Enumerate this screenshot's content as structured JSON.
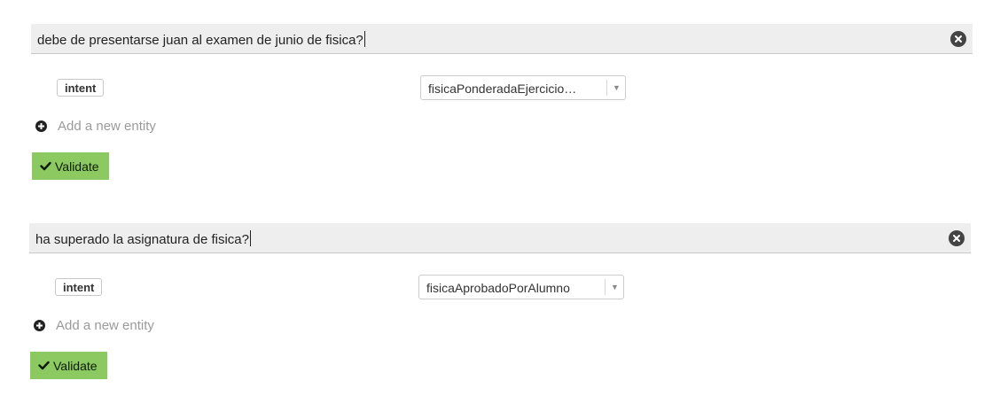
{
  "examples": [
    {
      "query": "debe de presentarse juan al examen de junio de fisica?",
      "entity_tag": "intent",
      "intent_value": "fisicaPonderadaEjercicio…",
      "add_entity_label": "Add a new entity",
      "validate_label": "Validate"
    },
    {
      "query": "ha superado la asignatura de fisica?",
      "entity_tag": "intent",
      "intent_value": "fisicaAprobadoPorAlumno",
      "add_entity_label": "Add a new entity",
      "validate_label": "Validate"
    }
  ],
  "icons": {
    "clear": "close-circle-icon",
    "dropdown": "caret-down-icon",
    "add": "plus-circle-icon",
    "validate": "check-icon"
  },
  "colors": {
    "query_bar": "#eeeeee",
    "validate_bg": "#8cc960",
    "muted_text": "#9a9a9a"
  }
}
